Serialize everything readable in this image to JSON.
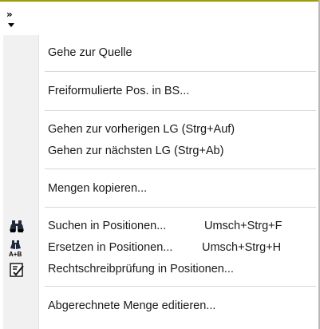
{
  "toolbar": {
    "overflow_glyph": "»"
  },
  "menu": {
    "items": [
      {
        "label": "Gehe zur Quelle",
        "shortcut": "",
        "icon": ""
      },
      {
        "label": "Freiformulierte Pos. in BS...",
        "shortcut": "",
        "icon": ""
      },
      {
        "label": "Gehen zur vorherigen LG (Strg+Auf)",
        "shortcut": "",
        "icon": ""
      },
      {
        "label": "Gehen zur nächsten LG (Strg+Ab)",
        "shortcut": "",
        "icon": ""
      },
      {
        "label": "Mengen kopieren...",
        "shortcut": "",
        "icon": ""
      },
      {
        "label": "Suchen in Positionen...",
        "shortcut": "Umsch+Strg+F",
        "icon": "binoculars-icon"
      },
      {
        "label": "Ersetzen in Positionen...",
        "shortcut": "Umsch+Strg+H",
        "icon": "binoculars-replace-icon"
      },
      {
        "label": "Rechtschreibprüfung in Positionen...",
        "shortcut": "",
        "icon": "spellcheck-icon"
      },
      {
        "label": "Abgerechnete Menge editieren...",
        "shortcut": "",
        "icon": ""
      }
    ],
    "replace_icon_text": "A+B"
  },
  "colors": {
    "accent_line": "#9a9a1e"
  }
}
